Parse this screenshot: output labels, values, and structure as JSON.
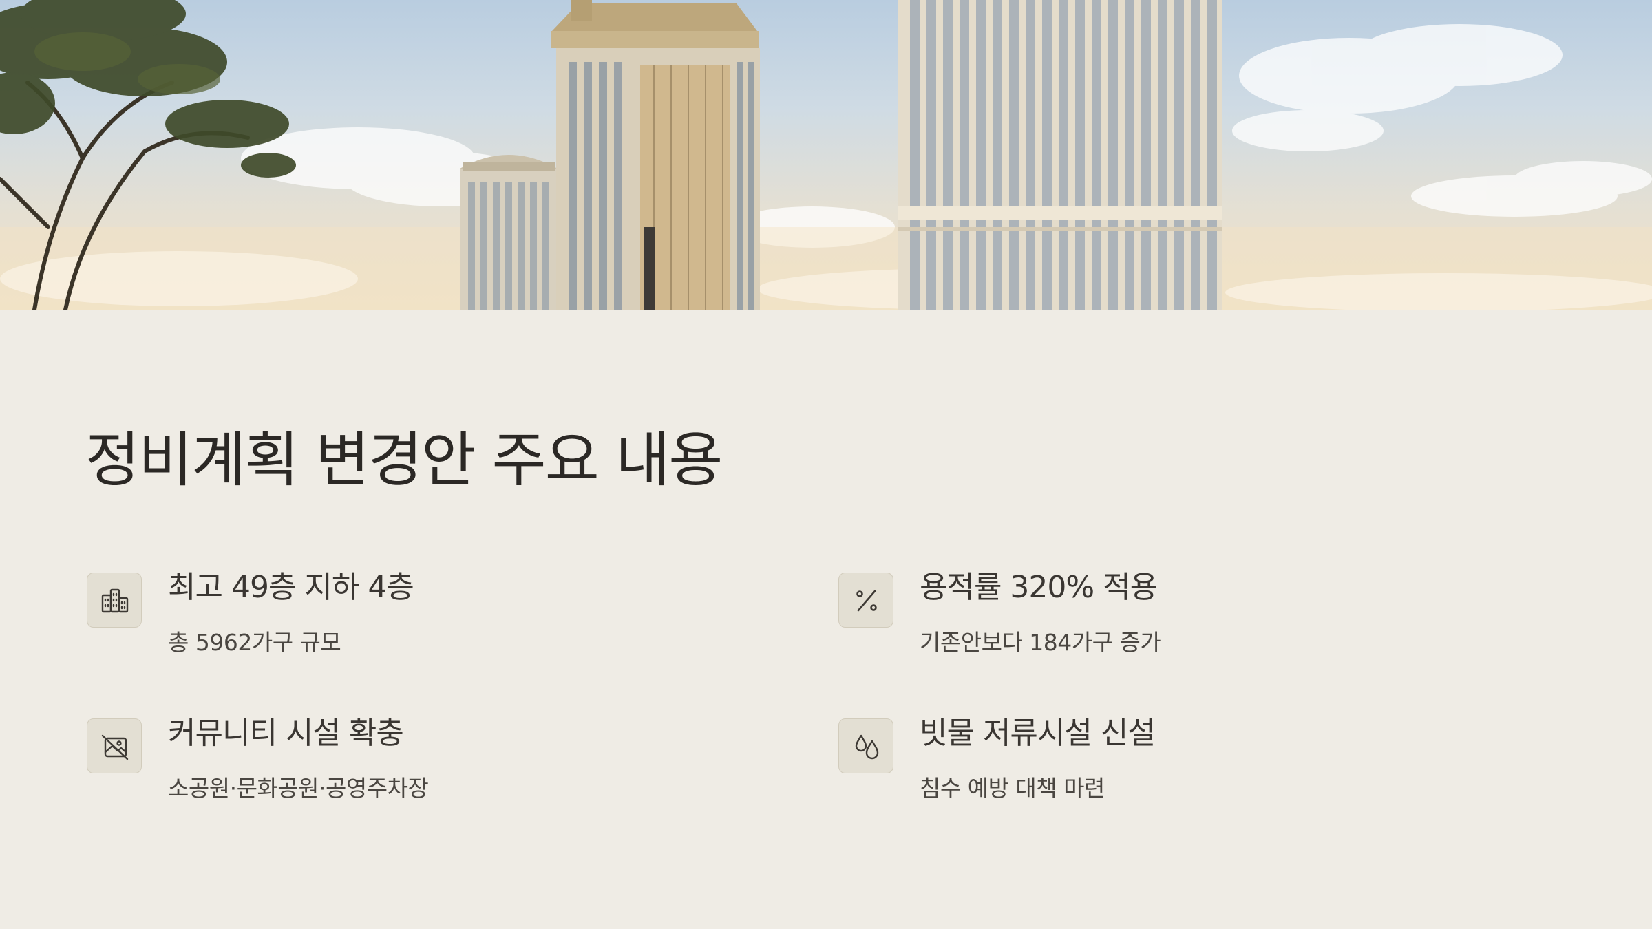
{
  "slide": {
    "title": "정비계획 변경안 주요 내용",
    "items": [
      {
        "icon": "buildings-icon",
        "title": "최고 49층 지하 4층",
        "desc": "총 5962가구 규모"
      },
      {
        "icon": "percent-icon",
        "title": "용적률 320% 적용",
        "desc": "기존안보다 184가구 증가"
      },
      {
        "icon": "no-image-icon",
        "title": "커뮤니티 시설 확충",
        "desc": "소공원·문화공원·공영주차장"
      },
      {
        "icon": "water-drops-icon",
        "title": "빗물 저류시설 신설",
        "desc": "침수 예방 대책 마련"
      }
    ]
  },
  "colors": {
    "background": "#efece5",
    "icon_box": "#e3dfd3",
    "title_text": "#2b2825"
  }
}
